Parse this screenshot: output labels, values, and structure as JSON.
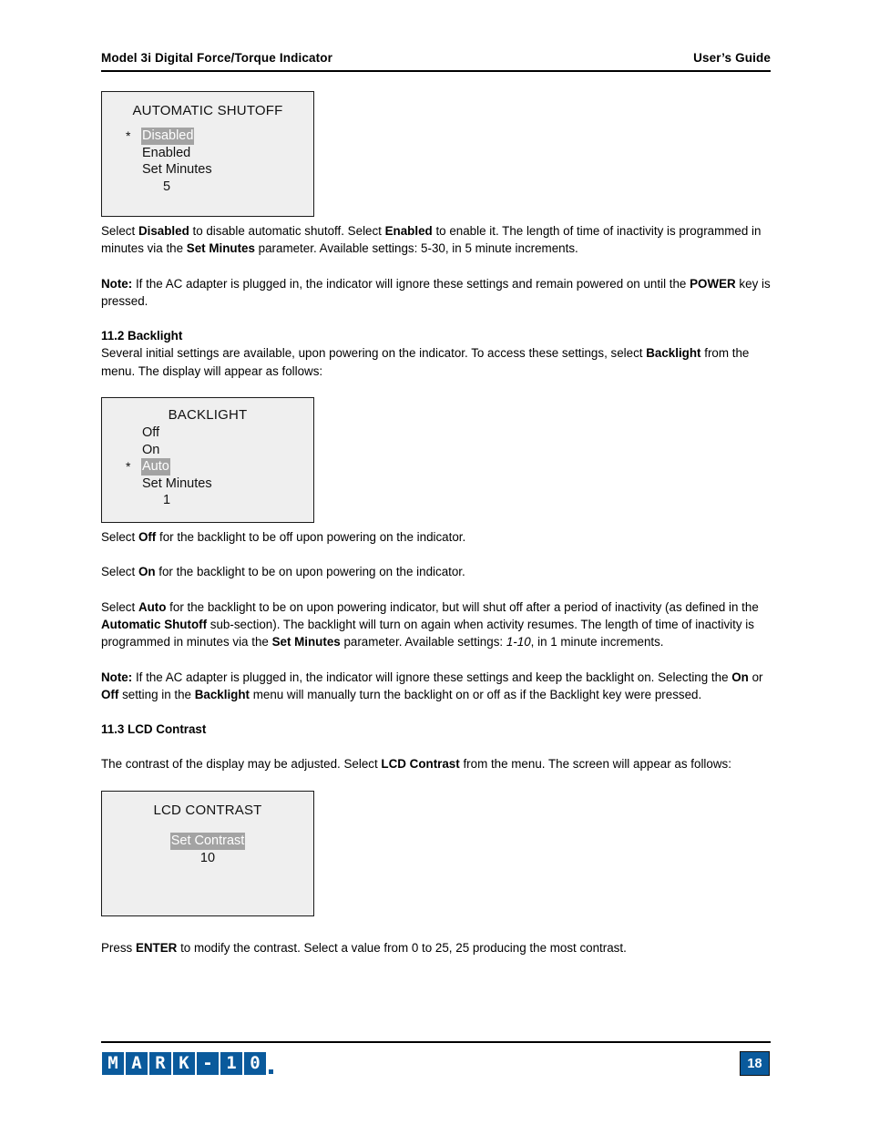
{
  "header": {
    "left_title": "Model 3i Digital Force/Torque Indicator",
    "right_title": "User’s Guide"
  },
  "screens": {
    "shutoff": {
      "title": "AUTOMATIC SHUTOFF",
      "rows": [
        {
          "star": "*",
          "label": "Disabled",
          "highlighted": true
        },
        {
          "star": "",
          "label": "Enabled",
          "highlighted": false
        },
        {
          "star": "",
          "label": "Set Minutes",
          "highlighted": false
        }
      ],
      "value": "5"
    },
    "backlight": {
      "title": "BACKLIGHT",
      "rows": [
        {
          "star": "",
          "label": "Off",
          "highlighted": false
        },
        {
          "star": "",
          "label": "On",
          "highlighted": false
        },
        {
          "star": "*",
          "label": "Auto",
          "highlighted": true
        },
        {
          "star": "",
          "label": "Set Minutes",
          "highlighted": false
        }
      ],
      "value": "1"
    },
    "contrast": {
      "title": "LCD CONTRAST",
      "label": "Set Contrast",
      "value": "10"
    }
  },
  "paragraphs": {
    "shutoff_desc": {
      "part1": "Select ",
      "b1": "Disabled",
      "part2": " to disable automatic shutoff. Select ",
      "b2": "Enabled",
      "part3": " to enable it. The length of time of inactivity is programmed in minutes via the ",
      "b3": "Set Minutes",
      "part4": " parameter. Available settings: 5-30, in 5 minute increments."
    },
    "shutoff_note": {
      "b1": "Note:",
      "part1": " If the AC adapter is plugged in, the indicator will ignore these settings and remain powered on until the ",
      "b2": "POWER",
      "part2": " key is pressed."
    },
    "sec_11_2_heading": "11.2 Backlight",
    "sec_11_2_intro": {
      "part1": "Several initial settings are available, upon powering on the indicator. To access these settings, select ",
      "b1": "Backlight",
      "part2": " from the menu. The display will appear as follows:"
    },
    "off_desc": {
      "part1": "Select ",
      "b1": "Off",
      "part2": " for the backlight to be off upon powering on the indicator."
    },
    "on_desc": {
      "part1": "Select ",
      "b1": "On",
      "part2": " for the backlight to be on upon powering on the indicator."
    },
    "auto_desc": {
      "part1": "Select ",
      "b1": "Auto",
      "part2": " for the backlight to be on upon powering indicator, but will shut off after a period of inactivity (as defined in the ",
      "b2": "Automatic Shutoff",
      "part3": " sub-section). The backlight will turn on again when activity resumes. The length of time of inactivity is programmed in minutes via the ",
      "b3": "Set Minutes",
      "part4": " parameter. Available settings: ",
      "i1": "1-10",
      "part5": ", in 1 minute increments."
    },
    "backlight_note": {
      "b1": "Note:",
      "part1": " If the AC adapter is plugged in, the indicator will ignore these settings and keep the backlight on. Selecting the ",
      "b2": "On",
      "part2": " or ",
      "b3": "Off",
      "part3": " setting in the ",
      "b4": "Backlight",
      "part4": " menu will manually turn the backlight on or off as if the Backlight key were pressed."
    },
    "sec_11_3_heading": "11.3 LCD Contrast",
    "sec_11_3_intro": {
      "part1": "The contrast of the display may be adjusted. Select ",
      "b1": "LCD Contrast",
      "part2": " from the menu. The screen will appear as follows:"
    },
    "contrast_desc": {
      "part1": "Press ",
      "b1": "ENTER",
      "part2": " to modify the contrast. Select a value from 0 to 25, 25 producing the most contrast."
    }
  },
  "footer": {
    "logo_cells": [
      "M",
      "A",
      "R",
      "K",
      "-",
      "1",
      "0"
    ],
    "page_number": "18"
  },
  "colors": {
    "brand_blue": "#0a5a9c",
    "lcd_background": "#efefef",
    "lcd_highlight": "#a3a3a3"
  }
}
